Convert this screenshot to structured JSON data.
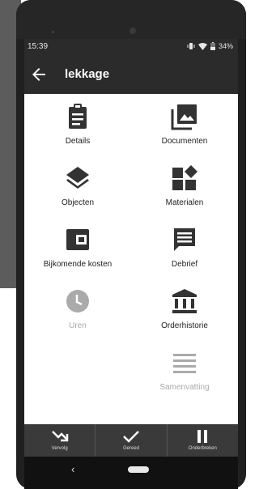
{
  "status_bar": {
    "time": "15:39",
    "battery": "34%"
  },
  "app_bar": {
    "title": "lekkage"
  },
  "menu": [
    {
      "label": "Details",
      "icon": "clipboard-icon",
      "enabled": true
    },
    {
      "label": "Documenten",
      "icon": "photo-library-icon",
      "enabled": true
    },
    {
      "label": "Objecten",
      "icon": "layers-icon",
      "enabled": true
    },
    {
      "label": "Materialen",
      "icon": "widgets-icon",
      "enabled": true
    },
    {
      "label": "Bijkomende kosten",
      "icon": "wallet-icon",
      "enabled": true
    },
    {
      "label": "Debrief",
      "icon": "message-icon",
      "enabled": true
    },
    {
      "label": "Uren",
      "icon": "clock-icon",
      "enabled": false
    },
    {
      "label": "Orderhistorie",
      "icon": "bank-icon",
      "enabled": true
    },
    {
      "label": "Samenvatting",
      "icon": "lines-icon",
      "enabled": false
    }
  ],
  "bottom_bar": [
    {
      "label": "Vervolg",
      "icon": "trending-down-icon"
    },
    {
      "label": "Gereed",
      "icon": "check-icon"
    },
    {
      "label": "Onderbreken",
      "icon": "pause-icon"
    }
  ],
  "colors": {
    "dark": "#2b2b2b",
    "icon": "#333333",
    "disabled": "#aaaaaa"
  }
}
